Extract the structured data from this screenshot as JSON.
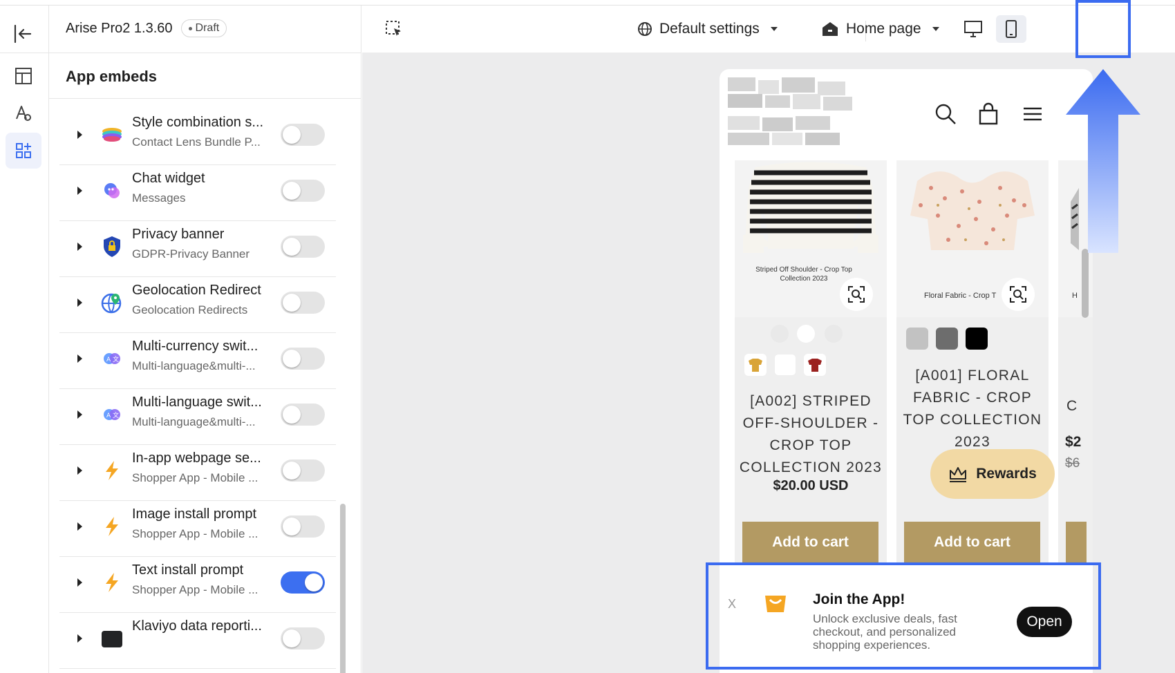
{
  "sidebar": {
    "theme_name": "Arise Pro2  1.3.60",
    "draft_label": "Draft",
    "panel_title": "App embeds",
    "items": [
      {
        "title": "Style combination s...",
        "subtitle": "Contact Lens Bundle P...",
        "enabled": false,
        "icon": "style-combination-icon"
      },
      {
        "title": "Chat widget",
        "subtitle": "Messages",
        "enabled": false,
        "icon": "chat-widget-icon"
      },
      {
        "title": "Privacy banner",
        "subtitle": "GDPR-Privacy Banner",
        "enabled": false,
        "icon": "privacy-shield-icon"
      },
      {
        "title": "Geolocation Redirect",
        "subtitle": "Geolocation Redirects",
        "enabled": false,
        "icon": "globe-pin-icon"
      },
      {
        "title": "Multi-currency swit...",
        "subtitle": "Multi-language&multi-...",
        "enabled": false,
        "icon": "translate-bubbles-icon"
      },
      {
        "title": "Multi-language swit...",
        "subtitle": "Multi-language&multi-...",
        "enabled": false,
        "icon": "translate-bubbles-icon"
      },
      {
        "title": "In-app webpage se...",
        "subtitle": "Shopper App - Mobile ...",
        "enabled": false,
        "icon": "shopper-bolt-icon"
      },
      {
        "title": "Image install prompt",
        "subtitle": "Shopper App - Mobile ...",
        "enabled": false,
        "icon": "shopper-bolt-icon"
      },
      {
        "title": "Text install prompt",
        "subtitle": "Shopper App - Mobile ...",
        "enabled": true,
        "icon": "shopper-bolt-icon"
      },
      {
        "title": "Klaviyo data reporti...",
        "subtitle": "",
        "enabled": false,
        "icon": "klaviyo-icon"
      }
    ]
  },
  "topbar": {
    "settings_label": "Default settings",
    "page_label": "Home page",
    "active_device": "mobile"
  },
  "preview": {
    "products": [
      {
        "image_caption": "Striped Off Shoulder - Crop Top Collection 2023",
        "title": "[A002] STRIPED OFF-SHOULDER - CROP TOP COLLECTION 2023",
        "price": "$20.00 USD",
        "button": "Add to cart"
      },
      {
        "image_caption": "Floral Fabric - Crop T",
        "title": "[A001] FLORAL FABRIC - CROP TOP COLLECTION 2023",
        "price": "",
        "button": "Add to cart"
      },
      {
        "image_caption": "H",
        "title": "C",
        "price": "$2",
        "compare_price": "$6",
        "button": ""
      }
    ],
    "rewards_label": "Rewards",
    "banner": {
      "close": "X",
      "title": "Join the App!",
      "description": "Unlock exclusive deals, fast checkout, and personalized shopping experiences.",
      "open_label": "Open"
    }
  },
  "colors": {
    "accent": "#3c6ff0",
    "highlight": "#3b6bf0",
    "add_to_cart": "#b39a63",
    "rewards": "#f2d9a4"
  }
}
